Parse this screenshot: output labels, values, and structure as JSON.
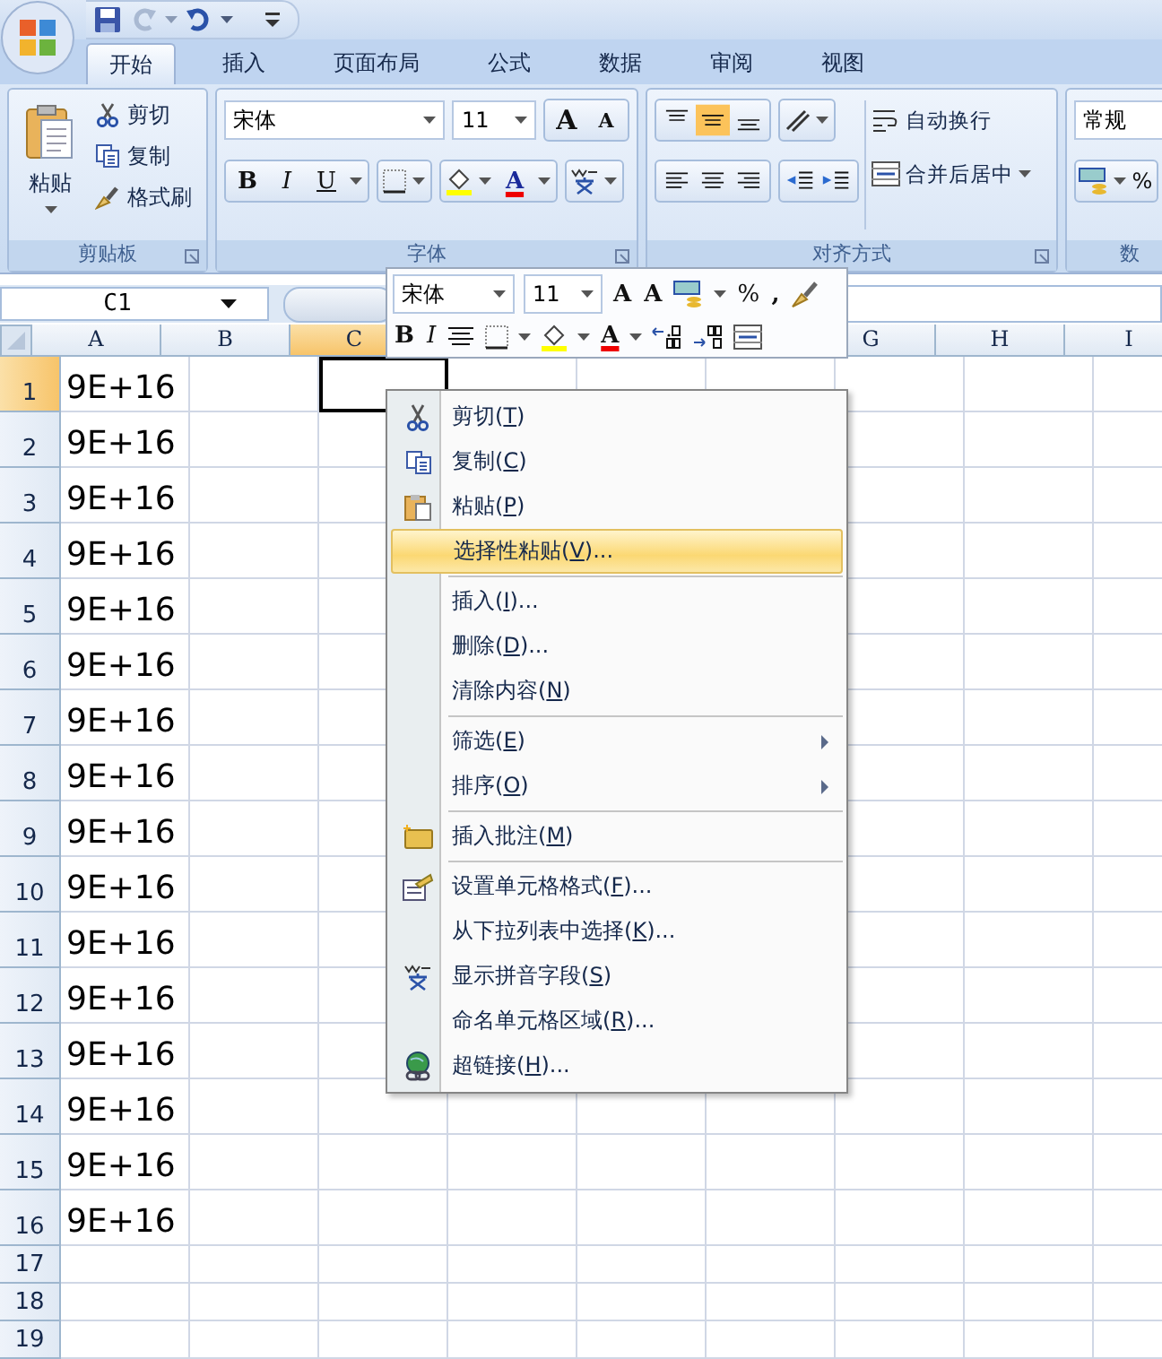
{
  "quick_access": {
    "undo": {
      "disabled": false
    },
    "redo": {
      "disabled": true
    }
  },
  "tabs": [
    {
      "label": "开始",
      "selected": true
    },
    {
      "label": "插入",
      "selected": false
    },
    {
      "label": "页面布局",
      "selected": false
    },
    {
      "label": "公式",
      "selected": false
    },
    {
      "label": "数据",
      "selected": false
    },
    {
      "label": "审阅",
      "selected": false
    },
    {
      "label": "视图",
      "selected": false
    }
  ],
  "clipboard": {
    "title": "剪贴板",
    "paste": "粘贴",
    "items": [
      {
        "kind": "cut",
        "label": "剪切"
      },
      {
        "kind": "copy",
        "label": "复制"
      },
      {
        "kind": "painter",
        "label": "格式刷"
      }
    ]
  },
  "font": {
    "title": "字体",
    "font_name": "宋体",
    "font_size": "11",
    "grow": "A",
    "shrink": "A",
    "bold": "B",
    "italic": "I",
    "underline": "U",
    "font_color": "A"
  },
  "alignment": {
    "title": "对齐方式",
    "vertical": [
      {
        "kind": "top",
        "selected": false
      },
      {
        "kind": "middle",
        "selected": true
      },
      {
        "kind": "bottom",
        "selected": false
      }
    ],
    "horizontal": [
      {
        "kind": "left",
        "selected": false
      },
      {
        "kind": "center",
        "selected": false
      },
      {
        "kind": "right",
        "selected": false
      }
    ],
    "wrap": "自动换行",
    "merge": "合并后居中"
  },
  "number": {
    "title": "数",
    "format": "常规",
    "percent": "%"
  },
  "name_box": "C1",
  "columns": [
    {
      "label": "A",
      "selected": false
    },
    {
      "label": "B",
      "selected": false
    },
    {
      "label": "C",
      "selected": true
    },
    {},
    {},
    {},
    {
      "label": "G",
      "selected": false
    },
    {
      "label": "H",
      "selected": false
    },
    {
      "label": "I",
      "selected": false
    }
  ],
  "rows": [
    {
      "number": "1",
      "selected": true,
      "cells": [
        "9E+16"
      ]
    },
    {
      "number": "2",
      "selected": false,
      "cells": [
        "9E+16"
      ]
    },
    {
      "number": "3",
      "selected": false,
      "cells": [
        "9E+16"
      ]
    },
    {
      "number": "4",
      "selected": false,
      "cells": [
        "9E+16"
      ]
    },
    {
      "number": "5",
      "selected": false,
      "cells": [
        "9E+16"
      ]
    },
    {
      "number": "6",
      "selected": false,
      "cells": [
        "9E+16"
      ]
    },
    {
      "number": "7",
      "selected": false,
      "cells": [
        "9E+16"
      ]
    },
    {
      "number": "8",
      "selected": false,
      "cells": [
        "9E+16"
      ]
    },
    {
      "number": "9",
      "selected": false,
      "cells": [
        "9E+16"
      ]
    },
    {
      "number": "10",
      "selected": false,
      "cells": [
        "9E+16"
      ]
    },
    {
      "number": "11",
      "selected": false,
      "cells": [
        "9E+16"
      ]
    },
    {
      "number": "12",
      "selected": false,
      "cells": [
        "9E+16"
      ]
    },
    {
      "number": "13",
      "selected": false,
      "cells": [
        "9E+16"
      ]
    },
    {
      "number": "14",
      "selected": false,
      "cells": [
        "9E+16"
      ]
    },
    {
      "number": "15",
      "selected": false,
      "cells": [
        "9E+16"
      ]
    },
    {
      "number": "16",
      "selected": false,
      "cells": [
        "9E+16"
      ]
    },
    {
      "number": "17",
      "selected": false
    },
    {
      "number": "18",
      "selected": false
    },
    {
      "number": "19",
      "selected": false
    }
  ],
  "mini_toolbar": {
    "font_name": "宋体",
    "font_size": "11",
    "grow": "A",
    "shrink": "A",
    "percent": "%",
    "comma": ",",
    "bold": "B",
    "italic": "I",
    "font_color": "A"
  },
  "context_menu": [
    {
      "kind": "cut",
      "pre": "剪切(",
      "key": "T",
      "post": ")",
      "selected": false
    },
    {
      "kind": "copy",
      "pre": "复制(",
      "key": "C",
      "post": ")",
      "selected": false
    },
    {
      "kind": "paste",
      "pre": "粘贴(",
      "key": "P",
      "post": ")",
      "selected": false
    },
    {
      "kind": "item",
      "pre": "选择性粘贴(",
      "key": "V",
      "post": ")...",
      "selected": true
    },
    {
      "kind": "separator"
    },
    {
      "kind": "item",
      "pre": "插入(",
      "key": "I",
      "post": ")...",
      "selected": false
    },
    {
      "kind": "item",
      "pre": "删除(",
      "key": "D",
      "post": ")...",
      "selected": false
    },
    {
      "kind": "item",
      "pre": "清除内容(",
      "key": "N",
      "post": ")",
      "selected": false
    },
    {
      "kind": "separator"
    },
    {
      "kind": "submenu",
      "pre": "筛选(",
      "key": "E",
      "post": ")",
      "selected": false
    },
    {
      "kind": "submenu",
      "pre": "排序(",
      "key": "O",
      "post": ")",
      "selected": false
    },
    {
      "kind": "separator"
    },
    {
      "kind": "comment",
      "pre": "插入批注(",
      "key": "M",
      "post": ")",
      "selected": false
    },
    {
      "kind": "separator"
    },
    {
      "kind": "format",
      "pre": "设置单元格格式(",
      "key": "F",
      "post": ")...",
      "selected": false
    },
    {
      "kind": "item",
      "pre": "从下拉列表中选择(",
      "key": "K",
      "post": ")...",
      "selected": false
    },
    {
      "kind": "phonetic",
      "pre": "显示拼音字段(",
      "key": "S",
      "post": ")",
      "selected": false
    },
    {
      "kind": "item",
      "pre": "命名单元格区域(",
      "key": "R",
      "post": ")...",
      "selected": false
    },
    {
      "kind": "link",
      "pre": "超链接(",
      "key": "H",
      "post": ")...",
      "selected": false
    }
  ]
}
